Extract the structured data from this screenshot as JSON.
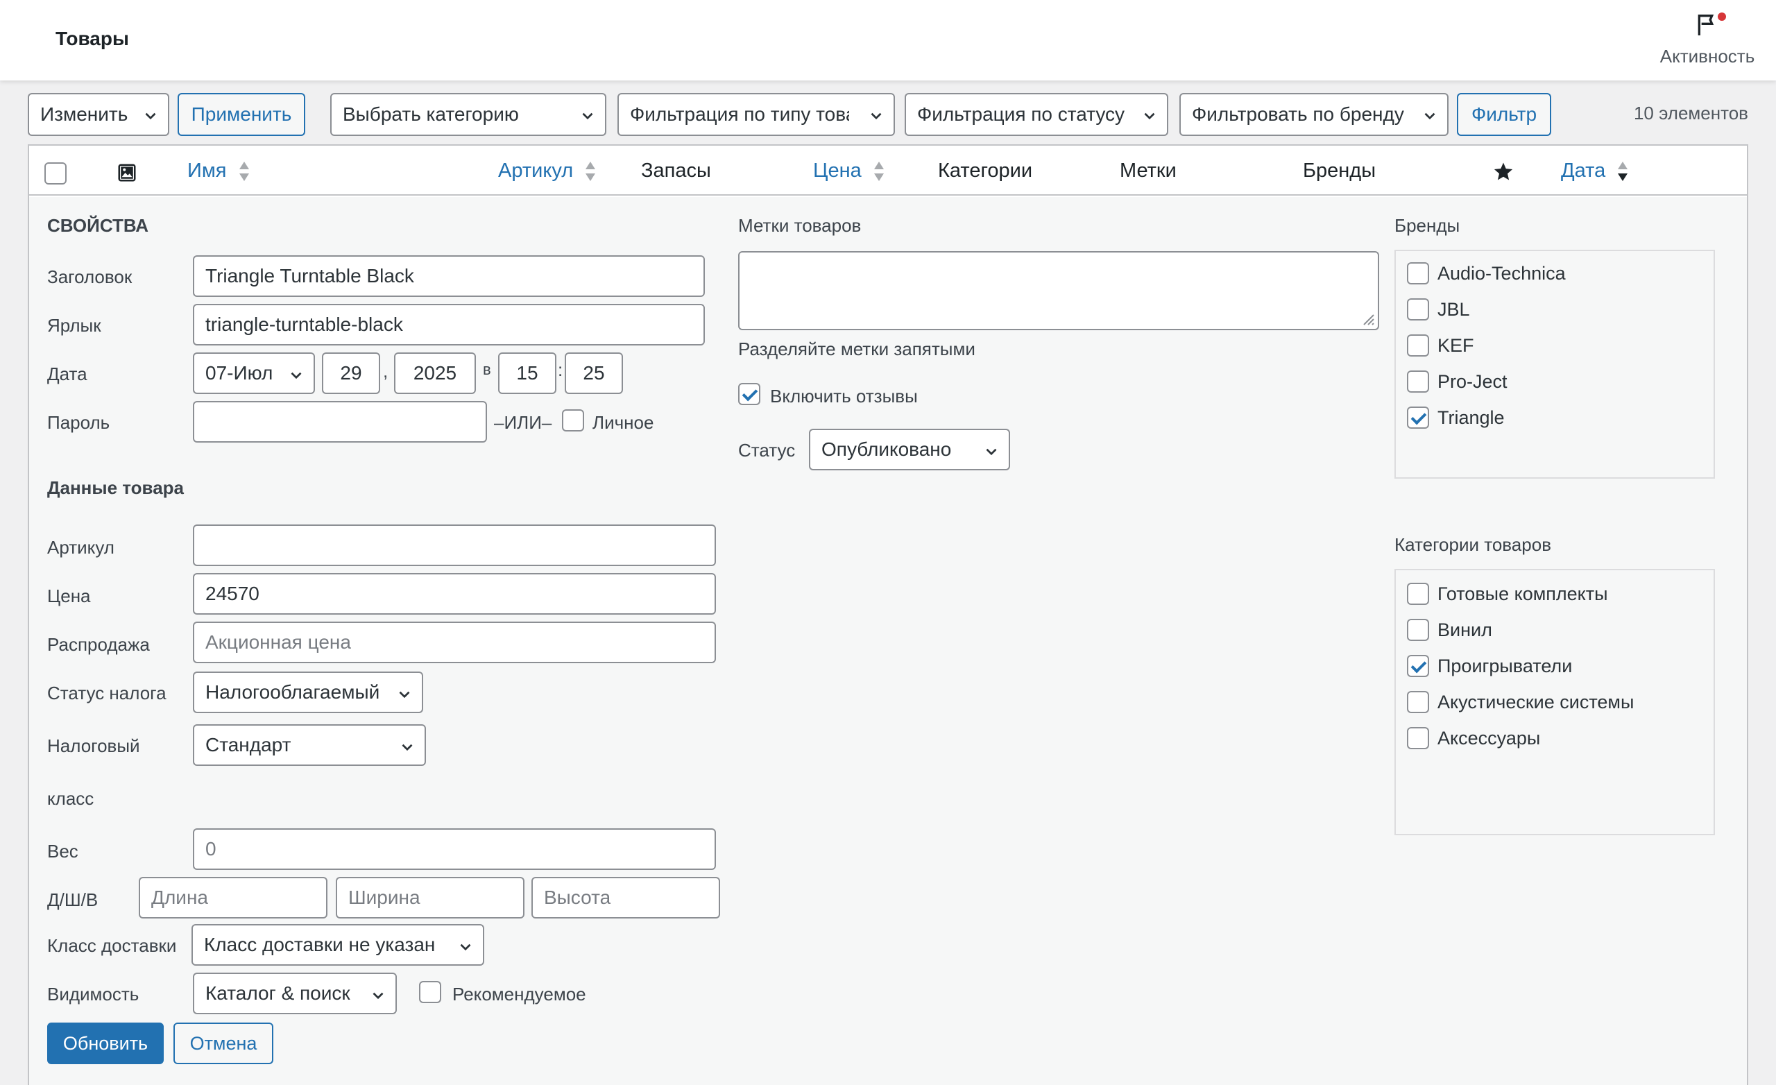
{
  "header": {
    "title": "Товары",
    "activity_label": "Активность"
  },
  "toolbar": {
    "bulk_action": "Изменить",
    "apply_label": "Применить",
    "category_filter": "Выбрать категорию",
    "type_filter": "Фильтрация по типу товара",
    "status_filter": "Фильтрация по статусу",
    "brand_filter": "Фильтровать по бренду",
    "filter_label": "Фильтр",
    "count": "10 элементов"
  },
  "columns": {
    "name": "Имя",
    "sku": "Артикул",
    "stock": "Запасы",
    "price": "Цена",
    "categories": "Категории",
    "tags": "Метки",
    "brands": "Бренды",
    "date": "Дата"
  },
  "quick_edit": {
    "properties_heading": "СВОЙСТВА",
    "title_label": "Заголовок",
    "title_value": "Triangle Turntable Black",
    "slug_label": "Ярлык",
    "slug_value": "triangle-turntable-black",
    "date_label": "Дата",
    "date": {
      "month": "07-Июл",
      "day": "29",
      "comma": ",",
      "year": "2025",
      "at": "в",
      "hour": "15",
      "colon": ":",
      "minute": "25"
    },
    "password_label": "Пароль",
    "password_value": "",
    "or_label": "–ИЛИ–",
    "private_label": "Личное",
    "product_data_heading": "Данные товара",
    "sku_label": "Артикул",
    "sku_value": "",
    "price_label": "Цена",
    "price_value": "24570",
    "sale_label": "Распродажа",
    "sale_placeholder": "Акционная цена",
    "tax_status_label": "Статус налога",
    "tax_status_value": "Налогооблагаемый",
    "tax_class_label_1": "Налоговый",
    "tax_class_label_2": "класс",
    "tax_class_value": "Стандарт",
    "weight_label": "Вес",
    "weight_placeholder": "0",
    "dims_label": "Д/Ш/В",
    "length_placeholder": "Длина",
    "width_placeholder": "Ширина",
    "height_placeholder": "Высота",
    "shipping_label": "Класс доставки",
    "shipping_value": "Класс доставки не указан",
    "visibility_label": "Видимость",
    "visibility_value": "Каталог & поиск",
    "featured_label": "Рекомендуемое",
    "tags_heading": "Метки товаров",
    "tags_hint": "Разделяйте метки запятыми",
    "comments_label": "Включить отзывы",
    "status_label": "Статус",
    "status_value": "Опубликовано",
    "brands_heading": "Бренды",
    "brands": [
      {
        "label": "Audio-Technica",
        "checked": false
      },
      {
        "label": "JBL",
        "checked": false
      },
      {
        "label": "KEF",
        "checked": false
      },
      {
        "label": "Pro-Ject",
        "checked": false
      },
      {
        "label": "Triangle",
        "checked": true
      }
    ],
    "categories_heading": "Категории товаров",
    "categories": [
      {
        "label": "Готовые комплекты",
        "checked": false
      },
      {
        "label": "Винил",
        "checked": false
      },
      {
        "label": "Проигрыватели",
        "checked": true
      },
      {
        "label": "Акустические системы",
        "checked": false
      },
      {
        "label": "Аксессуары",
        "checked": false
      }
    ],
    "update_label": "Обновить",
    "cancel_label": "Отмена"
  },
  "colors": {
    "accent": "#2271b1",
    "notification": "#d63638"
  }
}
